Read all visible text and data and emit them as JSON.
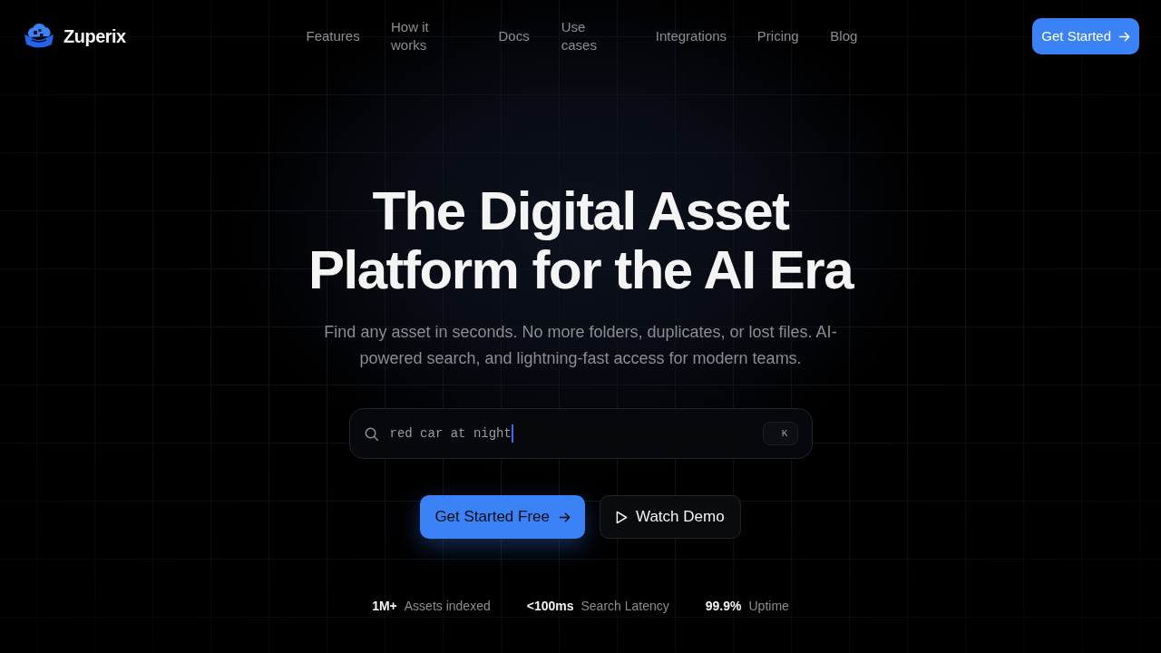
{
  "brand": {
    "name": "Zuperix"
  },
  "nav": {
    "links": [
      "Features",
      "How it works",
      "Docs",
      "Use cases",
      "Integrations",
      "Pricing",
      "Blog"
    ],
    "cta": "Get Started"
  },
  "hero": {
    "title": "The Digital Asset Platform for the AI Era",
    "subtitle": "Find any asset in seconds. No more folders, duplicates, or lost files. AI-powered search, and lightning-fast access for modern teams.",
    "search": {
      "value": "red car at night",
      "focused": true,
      "shortcut": "K"
    },
    "buttons": [
      {
        "label": "Get Started Free",
        "kind": "primary"
      },
      {
        "label": "Watch Demo",
        "kind": "secondary"
      }
    ]
  },
  "stats": [
    {
      "value": "1M+",
      "label": "Assets indexed"
    },
    {
      "value": "<100ms",
      "label": "Search Latency"
    },
    {
      "value": "99.9%",
      "label": "Uptime"
    }
  ]
}
